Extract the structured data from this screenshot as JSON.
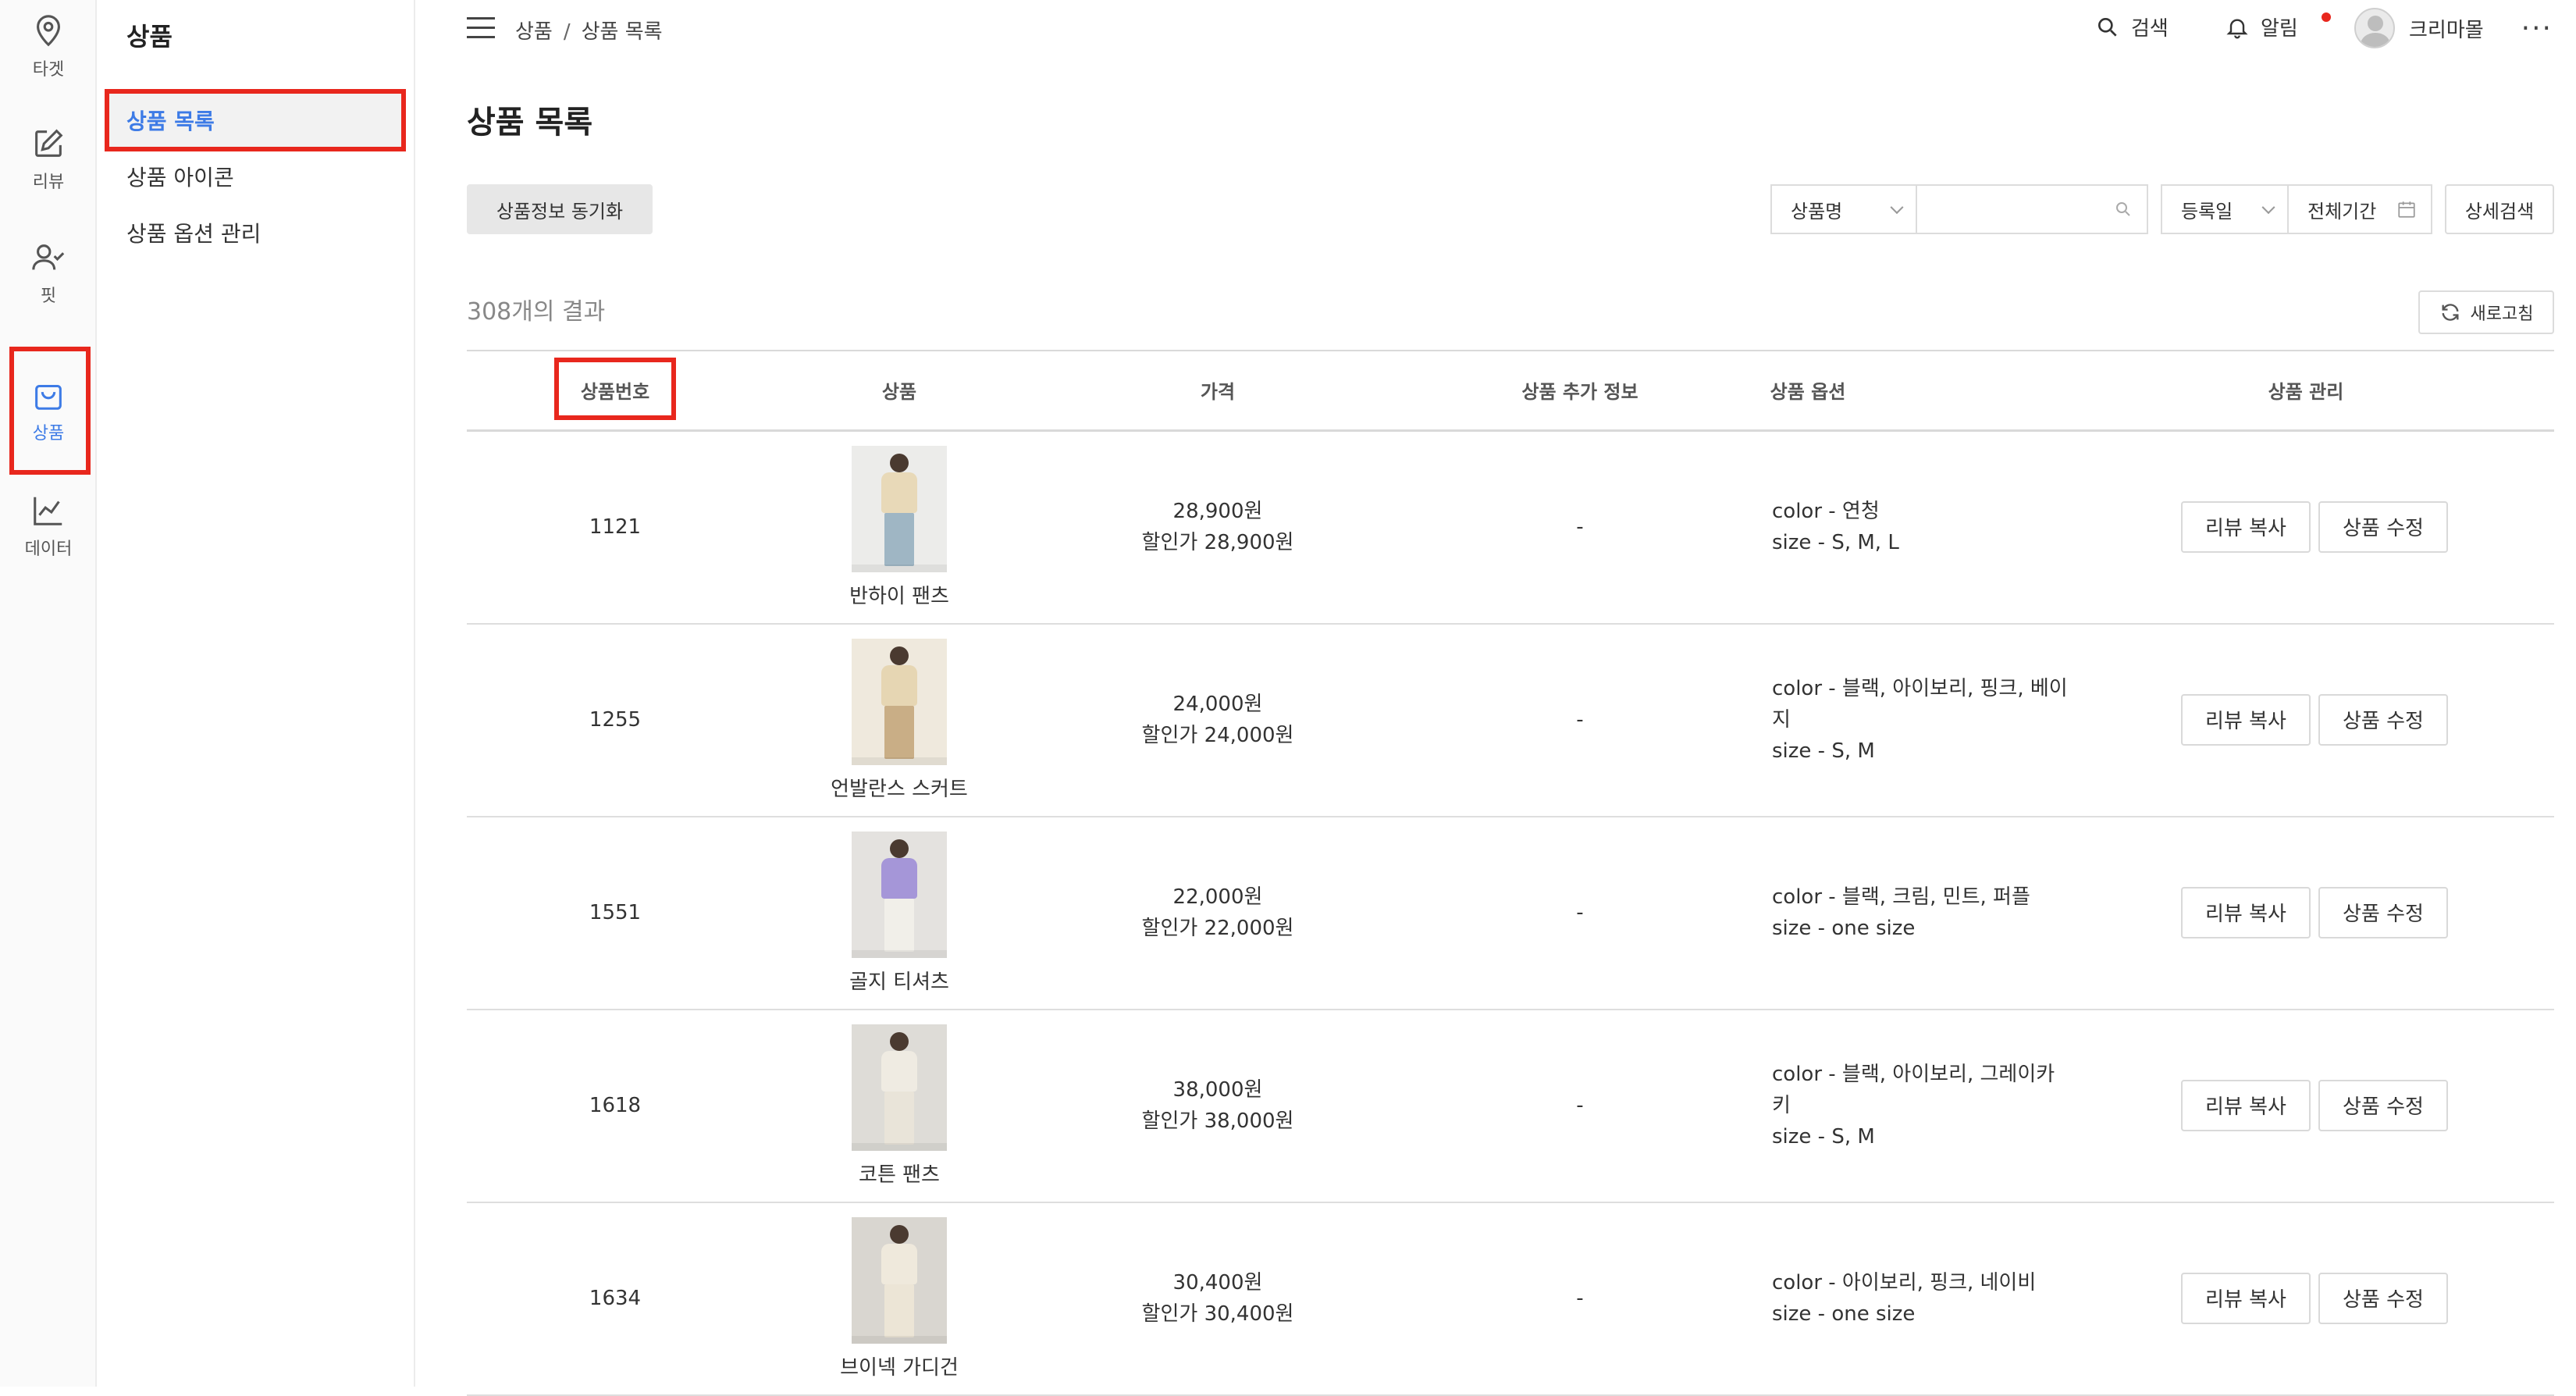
{
  "rail": [
    {
      "label": "타겟",
      "icon": "location-pin-icon"
    },
    {
      "label": "리뷰",
      "icon": "edit-icon"
    },
    {
      "label": "핏",
      "icon": "person-check-icon"
    },
    {
      "label": "상품",
      "icon": "shopping-bag-icon"
    },
    {
      "label": "데이터",
      "icon": "line-chart-icon"
    }
  ],
  "subnav": {
    "title": "상품",
    "items": [
      {
        "label": "상품 목록"
      },
      {
        "label": "상품 아이콘"
      },
      {
        "label": "상품 옵션 관리"
      }
    ]
  },
  "header": {
    "breadcrumb": [
      "상품",
      "상품 목록"
    ],
    "search_label": "검색",
    "alert_label": "알림",
    "user_name": "크리마몰",
    "more": "···"
  },
  "page": {
    "title": "상품 목록",
    "sync_button": "상품정보 동기화",
    "search_field_select": "상품명",
    "search_placeholder": "",
    "date_select": "등록일",
    "date_range": "전체기간",
    "advanced_search": "상세검색",
    "results_text": "308개의 결과",
    "refresh_button": "새로고침"
  },
  "table": {
    "headers": [
      "상품번호",
      "상품",
      "가격",
      "상품 추가 정보",
      "상품 옵션",
      "상품 관리"
    ],
    "rows": [
      {
        "id": "1121",
        "name": "반하이 팬츠",
        "price": "28,900원",
        "sale": "할인가 28,900원",
        "extra": "-",
        "options": "color - 연청\nsize - S, M, L",
        "top_color": "#e8d9b8",
        "bottom_color": "#9fb6c4",
        "bg": "#ececea"
      },
      {
        "id": "1255",
        "name": "언발란스 스커트",
        "price": "24,000원",
        "sale": "할인가 24,000원",
        "extra": "-",
        "options": "color - 블랙, 아이보리, 핑크, 베이\n지\nsize - S, M",
        "top_color": "#e6d6b3",
        "bottom_color": "#c9ae86",
        "bg": "#efe9dd"
      },
      {
        "id": "1551",
        "name": "골지 티셔츠",
        "price": "22,000원",
        "sale": "할인가 22,000원",
        "extra": "-",
        "options": "color - 블랙, 크림, 민트, 퍼플\nsize - one size",
        "top_color": "#a596d8",
        "bottom_color": "#f1efe9",
        "bg": "#e4e2df"
      },
      {
        "id": "1618",
        "name": "코튼 팬츠",
        "price": "38,000원",
        "sale": "할인가 38,000원",
        "extra": "-",
        "options": "color - 블랙, 아이보리, 그레이카\n키\nsize - S, M",
        "top_color": "#efebe2",
        "bottom_color": "#e9e4d9",
        "bg": "#dedcd7"
      },
      {
        "id": "1634",
        "name": "브이넥 가디건",
        "price": "30,400원",
        "sale": "할인가 30,400원",
        "extra": "-",
        "options": "color - 아이보리, 핑크, 네이비\nsize - one size",
        "top_color": "#efe9dc",
        "bottom_color": "#ece5d6",
        "bg": "#d9d6d0"
      }
    ],
    "review_copy": "리뷰 복사",
    "edit_product": "상품 수정"
  },
  "colors": {
    "accent": "#3d7be6",
    "highlight": "#e8271d",
    "alert_dot": "#e8271d"
  }
}
